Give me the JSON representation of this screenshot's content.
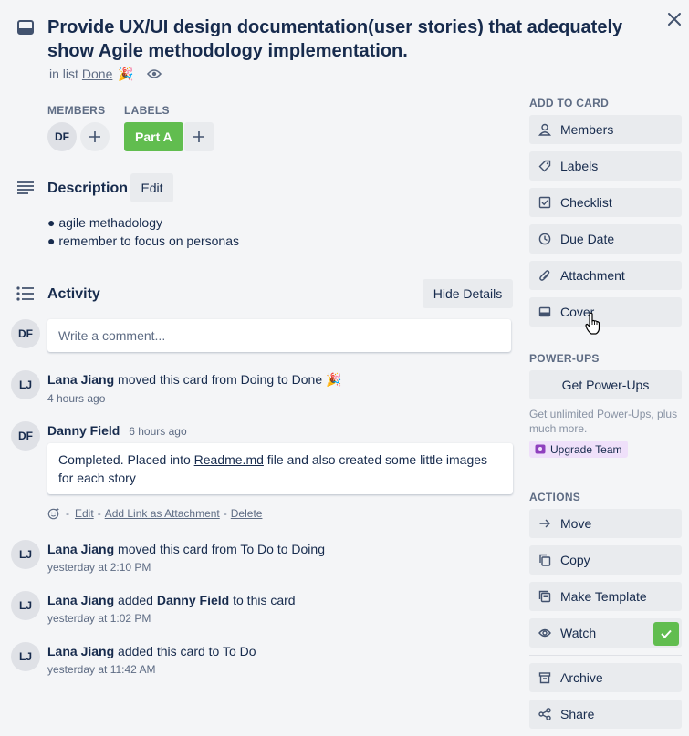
{
  "card": {
    "title": "Provide UX/UI design documentation(user stories) that adequately show Agile methodology implementation.",
    "in_list_prefix": "in list",
    "list_name": "Done",
    "list_emoji": "🎉"
  },
  "members": {
    "label": "MEMBERS",
    "avatars": [
      "DF"
    ]
  },
  "labels": {
    "label": "LABELS",
    "items": [
      {
        "text": "Part A",
        "color": "#61bd4f"
      }
    ]
  },
  "description": {
    "title": "Description",
    "edit_label": "Edit",
    "lines": [
      "● agile methadology",
      "● remember to focus on personas"
    ]
  },
  "activity": {
    "title": "Activity",
    "hide_details_label": "Hide Details",
    "comment_avatar": "DF",
    "comment_placeholder": "Write a comment...",
    "entries": [
      {
        "avatar": "LJ",
        "user": "Lana Jiang",
        "text": "moved this card from Doing to Done",
        "emoji": "🎉",
        "time": "4 hours ago"
      },
      {
        "avatar": "DF",
        "user": "Danny Field",
        "time": "6 hours ago",
        "comment_before": "Completed. Placed into ",
        "comment_link": "Readme.md",
        "comment_after": " file and also created some little images for each story",
        "actions": {
          "sep": "-",
          "edit": "Edit",
          "add_link": "Add Link as Attachment",
          "delete": "Delete"
        }
      },
      {
        "avatar": "LJ",
        "user": "Lana Jiang",
        "text": "moved this card from To Do to Doing",
        "time": "yesterday at 2:10 PM"
      },
      {
        "avatar": "LJ",
        "user": "Lana Jiang",
        "text_before": "added",
        "target": "Danny Field",
        "text_after": "to this card",
        "time": "yesterday at 1:02 PM"
      },
      {
        "avatar": "LJ",
        "user": "Lana Jiang",
        "text": "added this card to To Do",
        "time": "yesterday at 11:42 AM"
      }
    ]
  },
  "sidebar": {
    "add_to_card_label": "ADD TO CARD",
    "add_to_card": [
      {
        "label": "Members",
        "icon": "person-icon"
      },
      {
        "label": "Labels",
        "icon": "tag-icon"
      },
      {
        "label": "Checklist",
        "icon": "checklist-icon"
      },
      {
        "label": "Due Date",
        "icon": "clock-icon"
      },
      {
        "label": "Attachment",
        "icon": "paperclip-icon"
      },
      {
        "label": "Cover",
        "icon": "cover-icon"
      }
    ],
    "powerups_label": "POWER-UPS",
    "get_powerups_label": "Get Power-Ups",
    "powerups_note": "Get unlimited Power-Ups, plus much more.",
    "upgrade_label": "Upgrade Team",
    "actions_label": "ACTIONS",
    "actions": [
      {
        "label": "Move",
        "icon": "arrow-right-icon"
      },
      {
        "label": "Copy",
        "icon": "copy-icon"
      },
      {
        "label": "Make Template",
        "icon": "template-icon"
      },
      {
        "label": "Watch",
        "icon": "eye-icon",
        "checked": true
      }
    ],
    "more_actions": [
      {
        "label": "Archive",
        "icon": "archive-icon"
      },
      {
        "label": "Share",
        "icon": "share-icon"
      }
    ]
  },
  "colors": {
    "background": "#f4f5f7",
    "label_green": "#61bd4f",
    "button_gray": "#e9ebee",
    "text_primary": "#172b4d",
    "text_secondary": "#5e6c84"
  }
}
